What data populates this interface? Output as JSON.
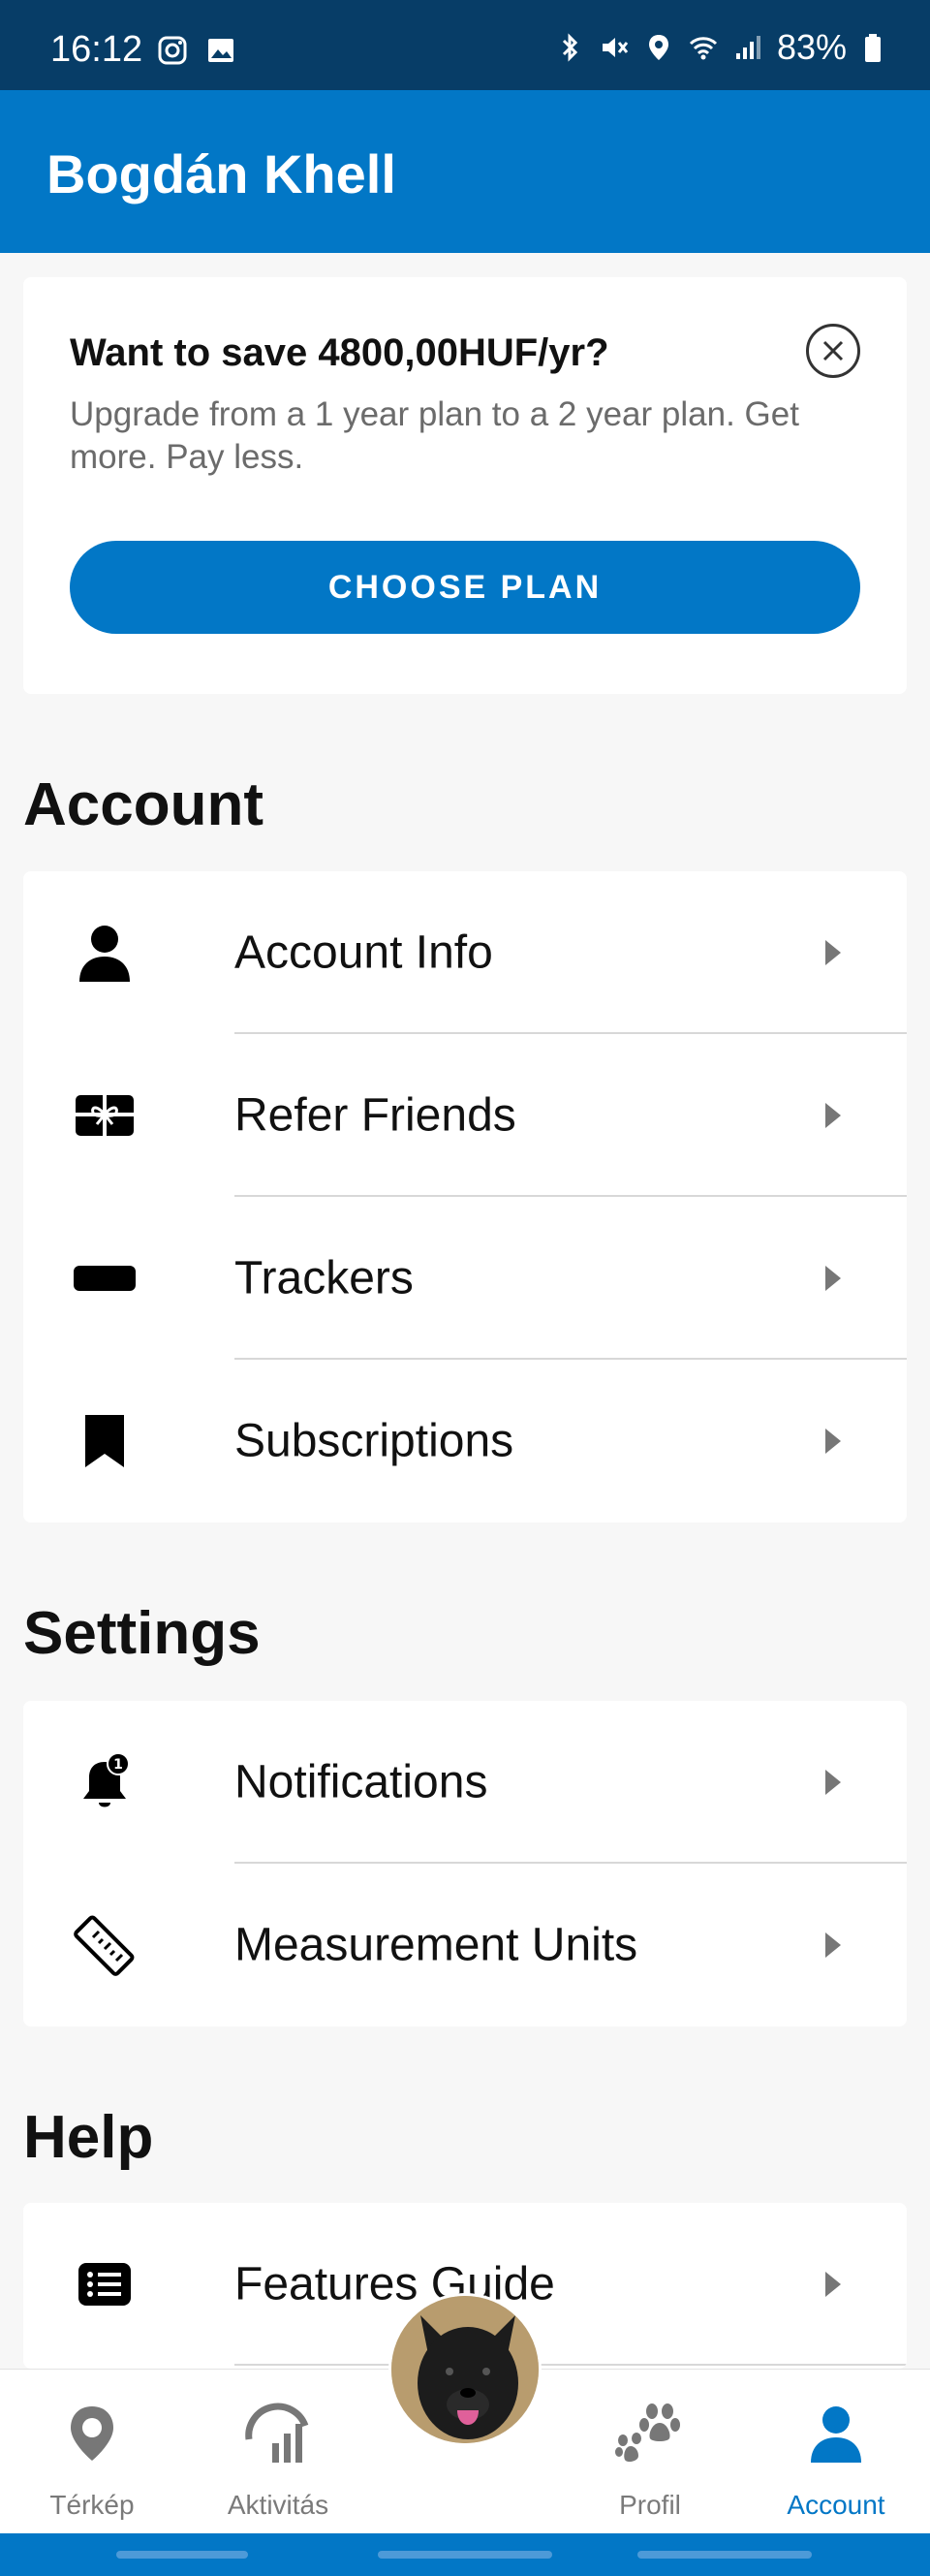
{
  "status_bar": {
    "time": "16:12",
    "battery": "83%"
  },
  "app_bar": {
    "title": "Bogdán Khell"
  },
  "promo": {
    "title": "Want to save 4800,00HUF/yr?",
    "description": "Upgrade from a 1 year plan to a 2 year plan. Get more. Pay less.",
    "cta_label": "CHOOSE PLAN"
  },
  "sections": {
    "account": {
      "heading": "Account",
      "items": [
        {
          "label": "Account Info",
          "icon": "person-icon"
        },
        {
          "label": "Refer Friends",
          "icon": "gift-card-icon"
        },
        {
          "label": "Trackers",
          "icon": "tracker-icon"
        },
        {
          "label": "Subscriptions",
          "icon": "bookmark-icon"
        }
      ]
    },
    "settings": {
      "heading": "Settings",
      "items": [
        {
          "label": "Notifications",
          "icon": "bell-icon",
          "badge": "1"
        },
        {
          "label": "Measurement Units",
          "icon": "ruler-icon"
        }
      ]
    },
    "help": {
      "heading": "Help",
      "items": [
        {
          "label": "Features Guide",
          "icon": "list-icon"
        }
      ]
    }
  },
  "bottom_nav": {
    "items": [
      {
        "label": "Térkép",
        "icon": "map-pin-icon"
      },
      {
        "label": "Aktivitás",
        "icon": "activity-icon"
      },
      {
        "label": "Profil",
        "icon": "paw-icon"
      },
      {
        "label": "Account",
        "icon": "account-icon"
      }
    ],
    "active": "Account"
  },
  "colors": {
    "primary": "#0277c6",
    "status_bar": "#073d67",
    "background": "#f7f7f7"
  }
}
